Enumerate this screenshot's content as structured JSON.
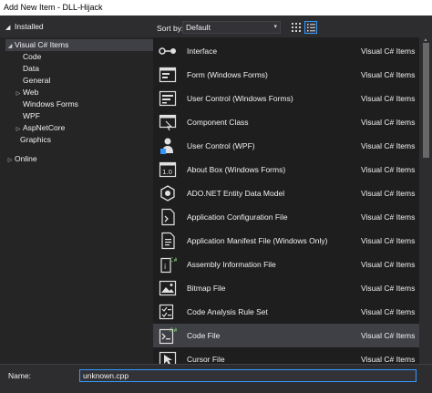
{
  "window": {
    "title": "Add New Item - DLL-Hijack"
  },
  "tree": {
    "header": "Installed",
    "items": [
      {
        "label": "Visual C# Items",
        "twisty": "◢",
        "selected": true
      },
      {
        "label": "Code",
        "twisty": ""
      },
      {
        "label": "Data",
        "twisty": ""
      },
      {
        "label": "General",
        "twisty": ""
      },
      {
        "label": "Web",
        "twisty": "▷"
      },
      {
        "label": "Windows Forms",
        "twisty": ""
      },
      {
        "label": "WPF",
        "twisty": ""
      },
      {
        "label": "AspNetCore",
        "twisty": "▷"
      },
      {
        "label": "Graphics",
        "twisty": ""
      },
      {
        "label": "Online",
        "twisty": "▷"
      }
    ]
  },
  "toolbar": {
    "sort_label": "Sort by:",
    "sort_value": "Default",
    "sort_chevron": "▾"
  },
  "templates": [
    {
      "name": "Interface",
      "category": "Visual C# Items",
      "icon": "interface-icon"
    },
    {
      "name": "Form (Windows Forms)",
      "category": "Visual C# Items",
      "icon": "form-icon"
    },
    {
      "name": "User Control (Windows Forms)",
      "category": "Visual C# Items",
      "icon": "user-control-icon"
    },
    {
      "name": "Component Class",
      "category": "Visual C# Items",
      "icon": "component-class-icon"
    },
    {
      "name": "User Control (WPF)",
      "category": "Visual C# Items",
      "icon": "wpf-user-control-icon"
    },
    {
      "name": "About Box (Windows Forms)",
      "category": "Visual C# Items",
      "icon": "about-box-icon"
    },
    {
      "name": "ADO.NET Entity Data Model",
      "category": "Visual C# Items",
      "icon": "entity-data-model-icon"
    },
    {
      "name": "Application Configuration File",
      "category": "Visual C# Items",
      "icon": "config-file-icon"
    },
    {
      "name": "Application Manifest File (Windows Only)",
      "category": "Visual C# Items",
      "icon": "manifest-file-icon"
    },
    {
      "name": "Assembly Information File",
      "category": "Visual C# Items",
      "icon": "assembly-info-icon"
    },
    {
      "name": "Bitmap File",
      "category": "Visual C# Items",
      "icon": "bitmap-icon"
    },
    {
      "name": "Code Analysis Rule Set",
      "category": "Visual C# Items",
      "icon": "rule-set-icon"
    },
    {
      "name": "Code File",
      "category": "Visual C# Items",
      "icon": "code-file-icon",
      "selected": true
    },
    {
      "name": "Cursor File",
      "category": "Visual C# Items",
      "icon": "cursor-file-icon"
    }
  ],
  "footer": {
    "name_label": "Name:",
    "name_value": "unknown.cpp"
  },
  "colors": {
    "background": "#252526",
    "list_background": "#1e1e1e",
    "selection": "#3f3f46",
    "focus_border": "#3399ff"
  }
}
